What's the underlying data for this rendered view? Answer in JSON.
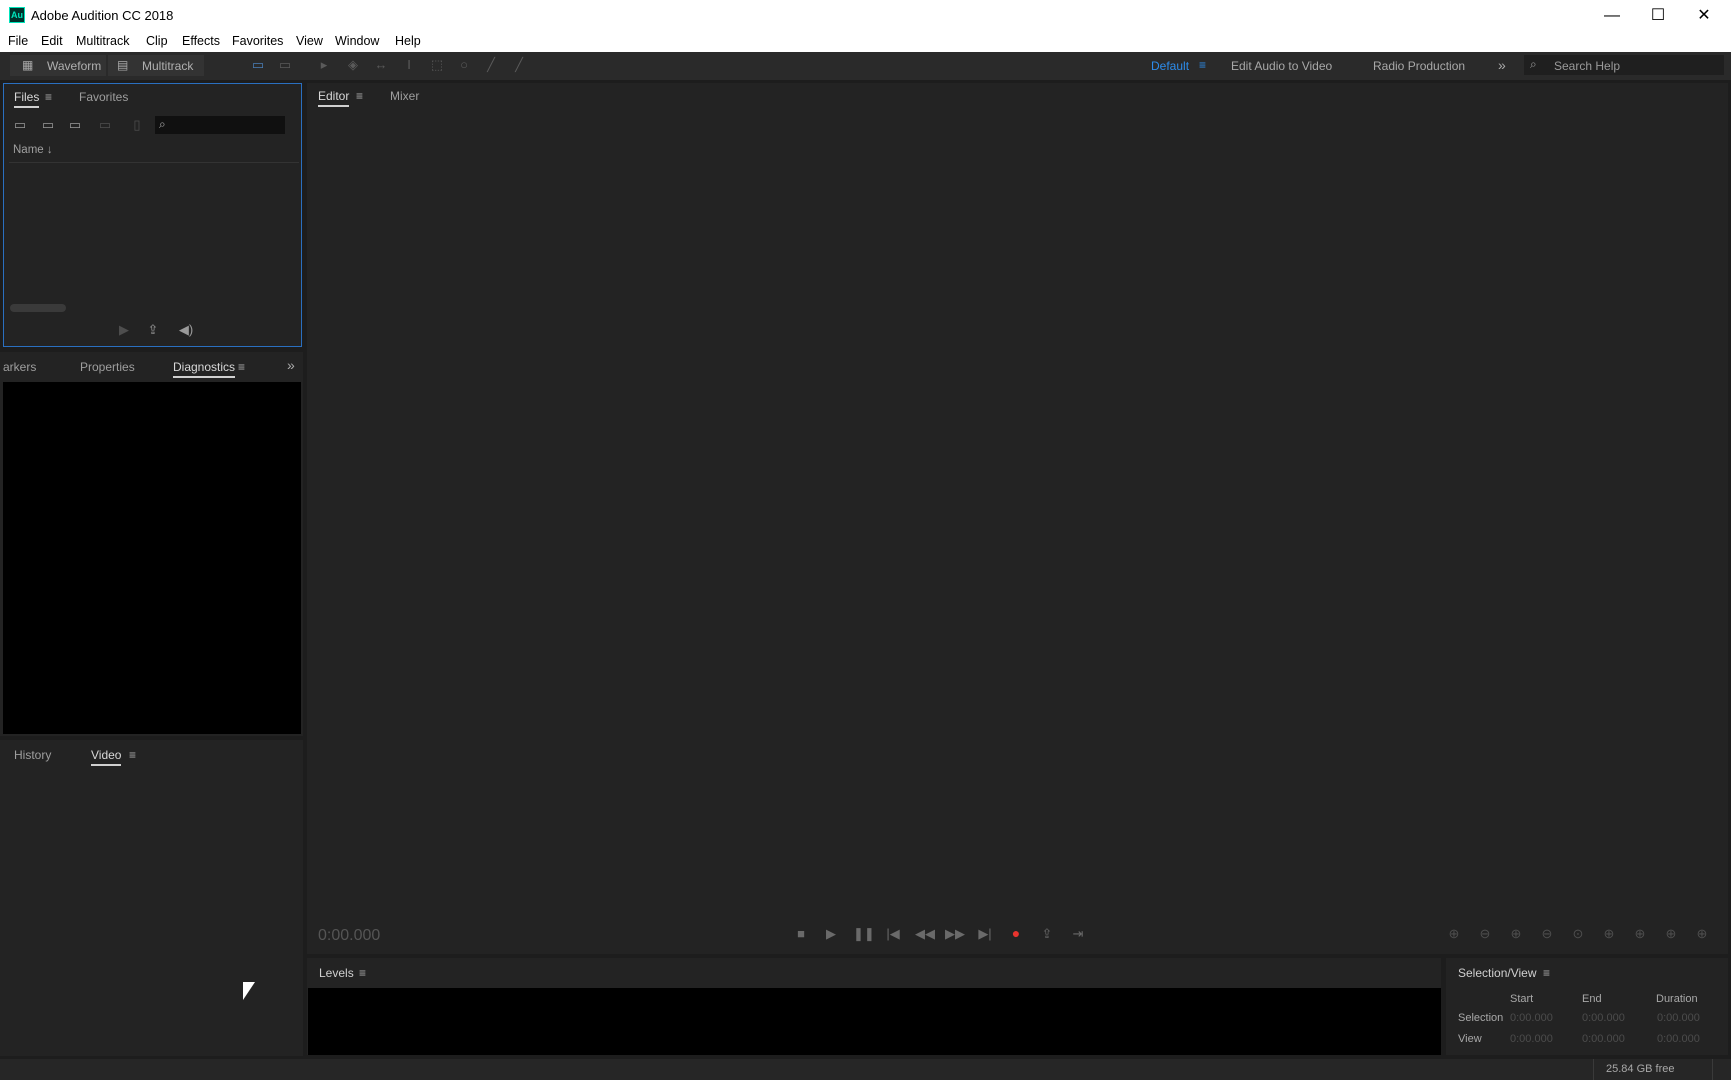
{
  "window": {
    "title": "Adobe Audition CC 2018",
    "app_icon_text": "Au",
    "minimize": "—",
    "maximize": "☐",
    "close": "✕"
  },
  "menu": [
    "File",
    "Edit",
    "Multitrack",
    "Clip",
    "Effects",
    "Favorites",
    "View",
    "Window",
    "Help"
  ],
  "toolbar": {
    "waveform": "Waveform",
    "multitrack": "Multitrack",
    "workspaces": [
      "Default",
      "Edit Audio to Video",
      "Radio Production"
    ],
    "search_placeholder": "Search Help"
  },
  "files_panel": {
    "tabs": [
      "Files",
      "Favorites"
    ],
    "column": "Name ↓"
  },
  "mid_panel": {
    "tabs": [
      "Markers",
      "Properties",
      "Diagnostics"
    ]
  },
  "bottom_left_panel": {
    "tabs": [
      "History",
      "Video"
    ]
  },
  "editor": {
    "tabs": [
      "Editor",
      "Mixer"
    ],
    "time": "0:00.000"
  },
  "levels": {
    "tab": "Levels"
  },
  "selection_view": {
    "tab": "Selection/View",
    "headers": [
      "Start",
      "End",
      "Duration"
    ],
    "rows": [
      {
        "label": "Selection",
        "values": [
          "0:00.000",
          "0:00.000",
          "0:00.000"
        ]
      },
      {
        "label": "View",
        "values": [
          "0:00.000",
          "0:00.000",
          "0:00.000"
        ]
      }
    ]
  },
  "status": {
    "free_space": "25.84 GB free"
  },
  "colors": {
    "accent": "#2d8ceb",
    "record": "#e8342e"
  }
}
